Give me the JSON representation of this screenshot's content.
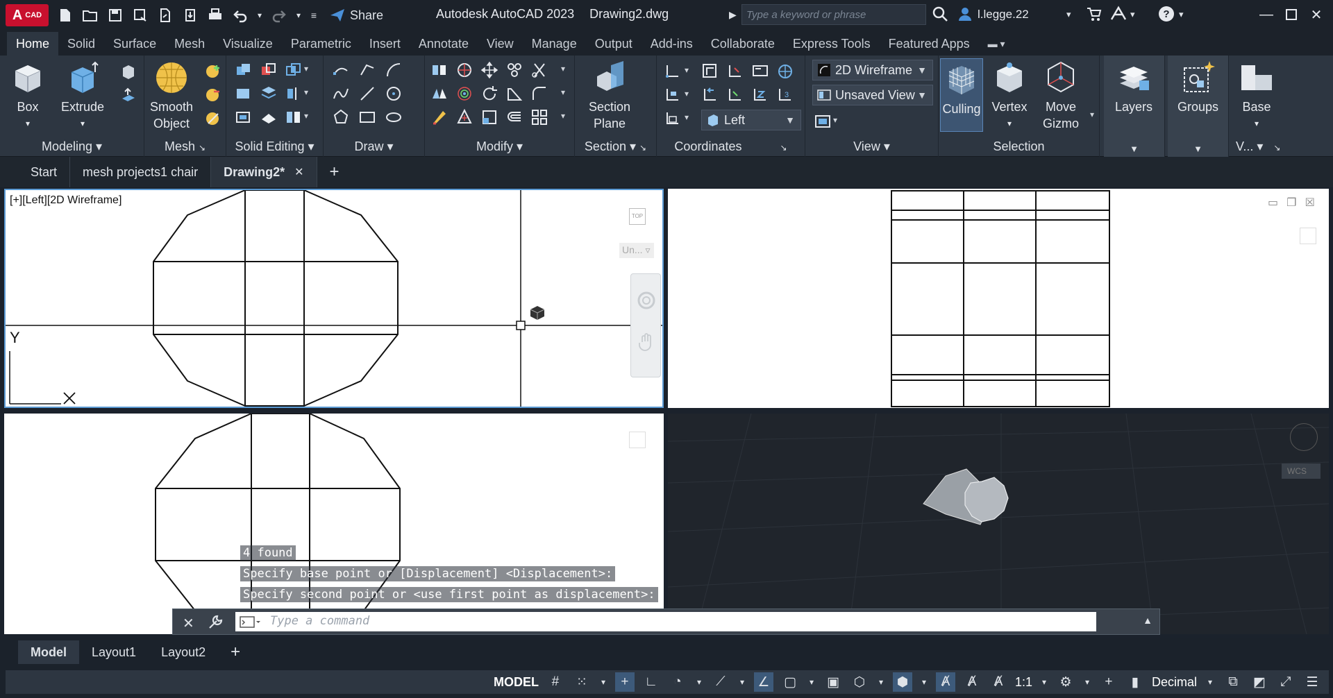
{
  "app": {
    "logo_main": "A",
    "logo_sub": "CAD",
    "share_label": "Share",
    "title": "Autodesk AutoCAD 2023",
    "filename": "Drawing2.dwg",
    "search_placeholder": "Type a keyword or phrase",
    "user": "l.legge.22"
  },
  "ribbon_tabs": [
    "Home",
    "Solid",
    "Surface",
    "Mesh",
    "Visualize",
    "Parametric",
    "Insert",
    "Annotate",
    "View",
    "Manage",
    "Output",
    "Add-ins",
    "Collaborate",
    "Express Tools",
    "Featured Apps"
  ],
  "ribbon": {
    "modeling": {
      "title": "Modeling",
      "box": "Box",
      "extrude": "Extrude"
    },
    "mesh": {
      "title": "Mesh",
      "smooth_line1": "Smooth",
      "smooth_line2": "Object"
    },
    "solid_editing": {
      "title": "Solid Editing"
    },
    "draw": {
      "title": "Draw"
    },
    "modify": {
      "title": "Modify"
    },
    "section": {
      "title": "Section",
      "plane_line1": "Section",
      "plane_line2": "Plane"
    },
    "coordinates": {
      "title": "Coordinates"
    },
    "view": {
      "title": "View",
      "visual_style": "2D Wireframe",
      "named_view": "Unsaved View",
      "view_dir": "Left"
    },
    "selection": {
      "title": "Selection",
      "culling": "Culling",
      "vertex": "Vertex",
      "gizmo_line1": "Move",
      "gizmo_line2": "Gizmo"
    },
    "layers": {
      "title": "Layers"
    },
    "groups": {
      "title": "Groups"
    },
    "base": {
      "title": "Base",
      "panel_short": "V..."
    }
  },
  "file_tabs": [
    "Start",
    "mesh projects1 chair",
    "Drawing2*"
  ],
  "viewports": {
    "top_left_label": "[+][Left][2D Wireframe]",
    "vc_unnamed": "Un...",
    "vc_top": "TOP",
    "wcs": "WCS",
    "ucs_y": "Y",
    "ucs_x": "X"
  },
  "command": {
    "log": [
      "4 found",
      "Specify base point or [Displacement] <Displacement>:",
      "Specify second point or <use first point as displacement>:"
    ],
    "placeholder": "Type a command"
  },
  "layout_tabs": [
    "Model",
    "Layout1",
    "Layout2"
  ],
  "status": {
    "model": "MODEL",
    "scale": "1:1",
    "units": "Decimal"
  },
  "colors": {
    "accent": "#4a90d9",
    "logo_red": "#c8102e",
    "ribbon_bg": "#2d3641",
    "viewport_active_border": "#5b9bd5"
  }
}
